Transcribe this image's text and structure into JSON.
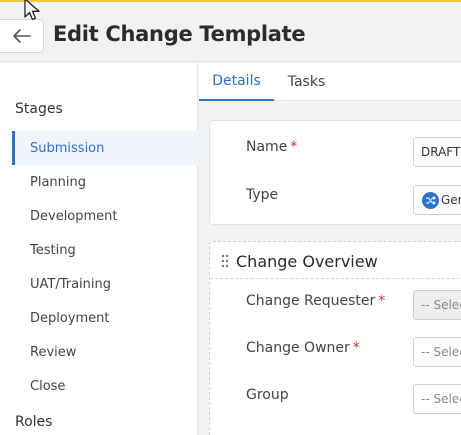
{
  "header": {
    "title": "Edit Change Template",
    "back_icon": "arrow-left-icon"
  },
  "sidebar": {
    "stages_heading": "Stages",
    "stages": [
      {
        "label": "Submission",
        "active": true
      },
      {
        "label": "Planning",
        "active": false
      },
      {
        "label": "Development",
        "active": false
      },
      {
        "label": "Testing",
        "active": false
      },
      {
        "label": "UAT/Training",
        "active": false
      },
      {
        "label": "Deployment",
        "active": false
      },
      {
        "label": "Review",
        "active": false
      },
      {
        "label": "Close",
        "active": false
      }
    ],
    "roles_heading": "Roles"
  },
  "tabs": [
    {
      "label": "Details",
      "active": true
    },
    {
      "label": "Tasks",
      "active": false
    }
  ],
  "details": {
    "name_label": "Name",
    "name_value": "DRAFT",
    "type_label": "Type",
    "type_value": "Ger",
    "type_icon": "shuffle-icon"
  },
  "overview": {
    "title": "Change Overview",
    "requester_label": "Change Requester",
    "requester_placeholder": "-- Selec",
    "owner_label": "Change Owner",
    "owner_placeholder": "-- Selec",
    "group_label": "Group",
    "group_placeholder": "-- Selec"
  },
  "colors": {
    "accent": "#2d72c8",
    "required": "#d9302c",
    "top_bar": "#f2c84b"
  }
}
